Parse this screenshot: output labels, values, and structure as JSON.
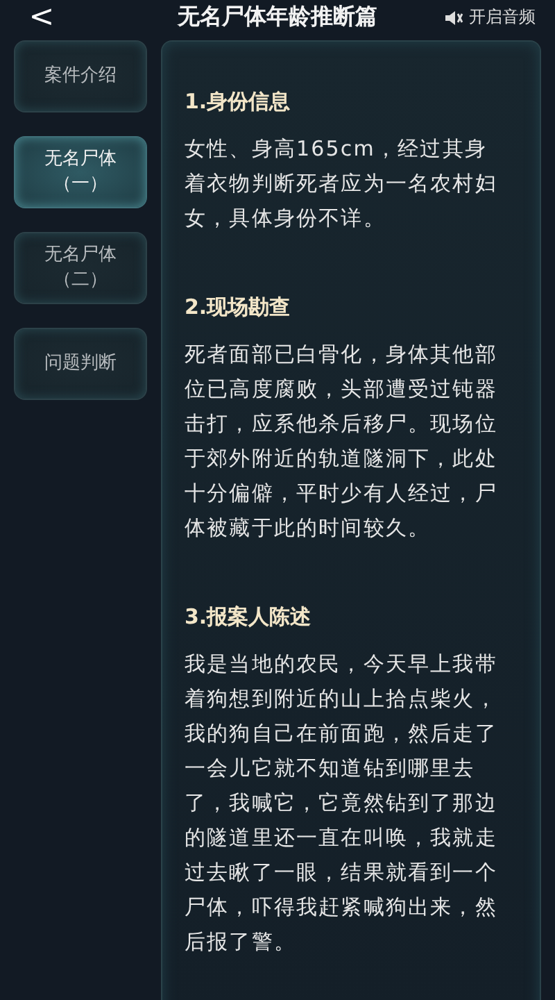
{
  "header": {
    "back": "<",
    "title": "无名尸体年龄推断篇",
    "audio": {
      "label": "开启音频",
      "on": false
    }
  },
  "sidebar": {
    "items": [
      {
        "label": "案件介绍",
        "selected": false
      },
      {
        "label": "无名尸体（一）",
        "selected": true
      },
      {
        "label": "无名尸体（二）",
        "selected": false
      },
      {
        "label": "问题判断",
        "selected": false
      }
    ]
  },
  "sections": [
    {
      "heading": "1.身份信息",
      "text": "女性、身高165cm，经过其身着衣物判断死者应为一名农村妇女，具体身份不详。"
    },
    {
      "heading": "2.现场勘查",
      "text": "死者面部已白骨化，身体其他部位已高度腐败，头部遭受过钝器击打，应系他杀后移尸。现场位于郊外附近的轨道隧洞下，此处十分偏僻，平时少有人经过，尸体被藏于此的时间较久。"
    },
    {
      "heading": "3.报案人陈述",
      "text": "我是当地的农民，今天早上我带着狗想到附近的山上拾点柴火，我的狗自己在前面跑，然后走了一会儿它就不知道钻到哪里去了，我喊它，它竟然钻到了那边的隧道里还一直在叫唤，我就走过去瞅了一眼，结果就看到一个尸体，吓得我赶紧喊狗出来，然后报了警。"
    }
  ]
}
